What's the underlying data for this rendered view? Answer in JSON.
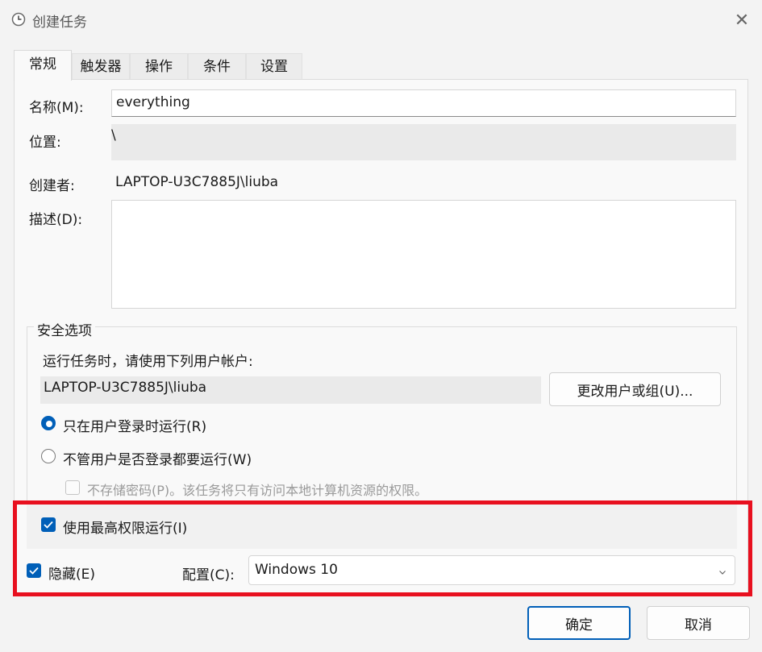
{
  "window": {
    "title": "创建任务",
    "close_symbol": "✕"
  },
  "tabs": [
    {
      "label": "常规",
      "active": true
    },
    {
      "label": "触发器",
      "active": false
    },
    {
      "label": "操作",
      "active": false
    },
    {
      "label": "条件",
      "active": false
    },
    {
      "label": "设置",
      "active": false
    }
  ],
  "general": {
    "name_label": "名称(M):",
    "name_value": "everything",
    "location_label": "位置:",
    "location_value": "\\",
    "author_label": "创建者:",
    "author_value": "LAPTOP-U3C7885J\\liuba",
    "description_label": "描述(D):",
    "description_value": ""
  },
  "security": {
    "legend": "安全选项",
    "run_as_prompt": "运行任务时，请使用下列用户帐户:",
    "account_value": "LAPTOP-U3C7885J\\liuba",
    "change_user_button": "更改用户或组(U)...",
    "radio_logged_on": {
      "label": "只在用户登录时运行(R)",
      "selected": true
    },
    "radio_always": {
      "label": "不管用户是否登录都要运行(W)",
      "selected": false
    },
    "no_store_password": {
      "label": "不存储密码(P)。该任务将只有访问本地计算机资源的权限。",
      "checked": false,
      "disabled": true
    },
    "highest_privileges": {
      "label": "使用最高权限运行(I)",
      "checked": true
    }
  },
  "hidden": {
    "label": "隐藏(E)",
    "checked": true
  },
  "configure": {
    "label": "配置(C):",
    "value": "Windows 10"
  },
  "buttons": {
    "ok": "确定",
    "cancel": "取消"
  },
  "colors": {
    "accent": "#005fb8",
    "highlight": "#e8101f"
  }
}
